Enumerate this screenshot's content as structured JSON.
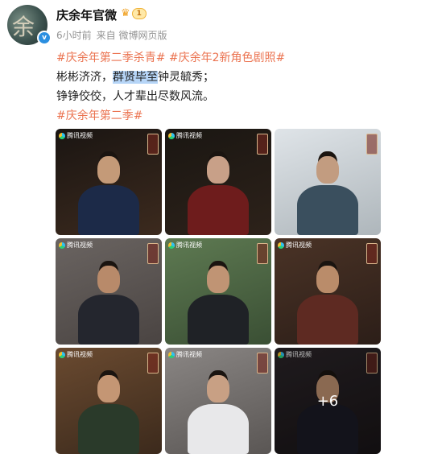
{
  "post": {
    "author": "庆余年官微",
    "vip_level": "1",
    "time": "6小时前",
    "source": "来自 微博网页版",
    "tags_line1": [
      "#庆余年第二季杀青#",
      "#庆余年2新角色剧照#"
    ],
    "line2_pre": "彬彬济济，",
    "line2_highlight": "群贤毕至",
    "line2_post": "钟灵毓秀；",
    "line3": "铮铮佼佼，人才辈出尽数风流。",
    "tag_line4": "#庆余年第二季#"
  },
  "images": [
    {
      "logo": "腾讯视频",
      "colors": [
        "#1a1512",
        "#3c2a1e"
      ],
      "head": "#c49a78",
      "body": "#1c2a48"
    },
    {
      "logo": "腾讯视频",
      "colors": [
        "#1a1612",
        "#2d221a"
      ],
      "head": "#c8a088",
      "body": "#6e1c1c"
    },
    {
      "logo": "",
      "colors": [
        "#dfe4e8",
        "#aeb6bb"
      ],
      "head": "#c29c80",
      "body": "#3a4f5e"
    },
    {
      "logo": "腾讯视频",
      "colors": [
        "#6a6461",
        "#4a4442"
      ],
      "head": "#b88a6a",
      "body": "#24262e"
    },
    {
      "logo": "腾讯视频",
      "colors": [
        "#5e7a52",
        "#3a4f34"
      ],
      "head": "#c09474",
      "body": "#1f2226"
    },
    {
      "logo": "腾讯视频",
      "colors": [
        "#4a3326",
        "#2c1e18"
      ],
      "head": "#ba8c6a",
      "body": "#5e2a22"
    },
    {
      "logo": "腾讯视频",
      "colors": [
        "#6a4a30",
        "#3c2a1c"
      ],
      "head": "#c49674",
      "body": "#2a3a2a"
    },
    {
      "logo": "腾讯视频",
      "colors": [
        "#8a8684",
        "#5a5654"
      ],
      "head": "#c8a084",
      "body": "#e8e8ea"
    },
    {
      "logo": "腾讯视频",
      "colors": [
        "#2a2428",
        "#181416"
      ],
      "head": "#b88c6c",
      "body": "#1a1a24"
    }
  ],
  "more_count": "+6"
}
